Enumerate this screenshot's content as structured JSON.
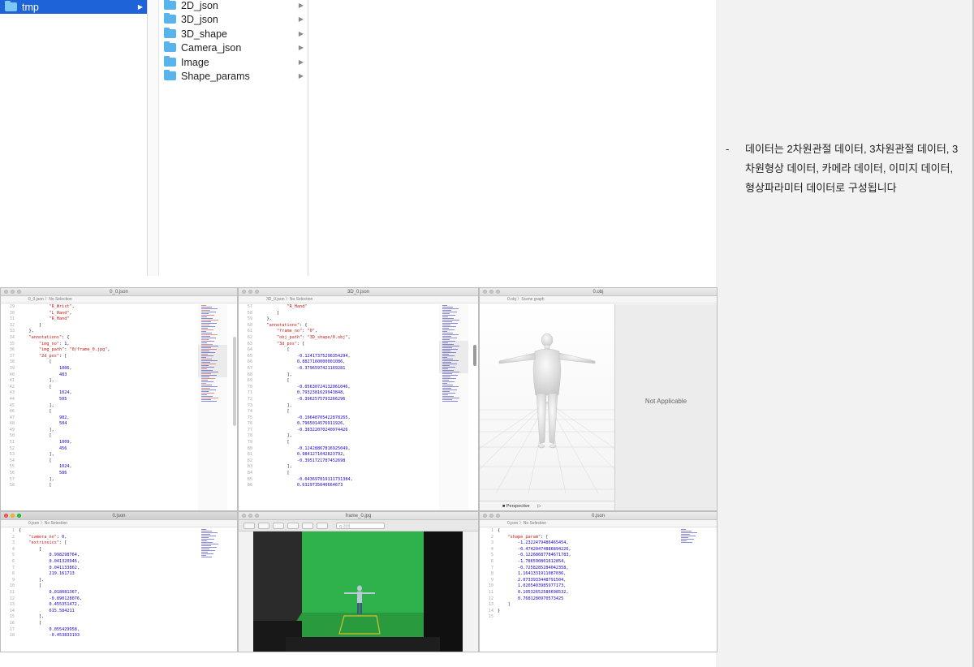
{
  "finder": {
    "column1": [
      {
        "label": "tmp",
        "selected": true
      }
    ],
    "column2": [
      {
        "label": "2D_json"
      },
      {
        "label": "3D_json"
      },
      {
        "label": "3D_shape"
      },
      {
        "label": "Camera_json"
      },
      {
        "label": "Image"
      },
      {
        "label": "Shape_params"
      }
    ]
  },
  "note": {
    "dash": "-",
    "text": "데이터는 2차원관절 데이터, 3차원관절 데이터, 3차원형상 데이터, 카메라 데이터, 이미지 데이터, 형상파라미터 데이터로 구성됩니다"
  },
  "windows": {
    "w1": {
      "title": "0_0.json",
      "jump": "0_0.json 〉No Selection",
      "line_numbers": [
        "29",
        "30",
        "31",
        "32",
        "33",
        "34",
        "35",
        "36",
        "37",
        "38",
        "39",
        "40",
        "41",
        "42",
        "43",
        "44",
        "45",
        "46",
        "47",
        "48",
        "49",
        "50",
        "51",
        "52",
        "53",
        "54",
        "55",
        "56",
        "57",
        "58"
      ],
      "lines": [
        "            \"R_Wrist\",",
        "            \"L_Hand\",",
        "            \"R_Hand\"",
        "        ]",
        "    },",
        "    \"annotations\": {",
        "        \"img_no\": 1,",
        "        \"img_path\": \"0/frame_0.jpg\",",
        "        \"2d_pos\": [",
        "            [",
        "                1006,",
        "                483",
        "            ],",
        "            [",
        "                1024,",
        "                505",
        "            ],",
        "            [",
        "                982,",
        "                504",
        "            ],",
        "            [",
        "                1009,",
        "                456",
        "            ],",
        "            [",
        "                1024,",
        "                586",
        "            ],",
        "            ["
      ]
    },
    "w2": {
      "title": "3D_0.json",
      "jump": "3D_0.json 〉No Selection",
      "line_numbers": [
        "57",
        "58",
        "59",
        "60",
        "61",
        "62",
        "63",
        "64",
        "65",
        "66",
        "67",
        "68",
        "69",
        "70",
        "71",
        "72",
        "73",
        "74",
        "75",
        "76",
        "77",
        "78",
        "79",
        "80",
        "81",
        "82",
        "83",
        "84",
        "85",
        "86"
      ],
      "lines": [
        "            \"R_Hand\"",
        "        ]",
        "    },",
        "    \"annotations\": {",
        "        \"frame_no\": \"0\",",
        "        \"obj_path\": \"3D_shape/0.obj\",",
        "        \"3d_pos\": [",
        "            [",
        "                -0.12417375296354294,",
        "                0.8827160000001086,",
        "                -0.3796597421169281",
        "            ],",
        "            [",
        "                -0.05630724132061046,",
        "                0.7932381629943848,",
        "                -0.3962575793266296",
        "            ],",
        "            [",
        "                -0.19648705422878265,",
        "                0.7965014576911926,",
        "                -0.38322070240974426",
        "            ],",
        "            [",
        "                -0.12428867816925049,",
        "                0.9841271042823792,",
        "                -0.3951721787452698",
        "            ],",
        "            [",
        "                -0.043697819111731384,",
        "                0.6329735040664673"
      ]
    },
    "w3": {
      "title": "0.obj",
      "jump": "0.obj 〉Scene graph",
      "not_applicable": "Not Applicable",
      "camera_mode": "Perspective"
    },
    "w4": {
      "title": "0.json",
      "jump": "0.json 〉No Selection",
      "line_numbers": [
        "1",
        "2",
        "3",
        "4",
        "5",
        "6",
        "7",
        "8",
        "9",
        "10",
        "11",
        "12",
        "13",
        "14",
        "15",
        "16",
        "17",
        "18"
      ],
      "lines": [
        "{",
        "    \"camera_no\": 0,",
        "    \"extrinsics\": [",
        "        [",
        "            0.998298764,",
        "            0.041320946,",
        "            0.041133862,",
        "            219.161713",
        "        ],",
        "        [",
        "            0.018081367,",
        "            -0.890128076,",
        "            0.455351472,",
        "            615.584211",
        "        ],",
        "        [",
        "            0.055429958,",
        "            -0.453833193"
      ]
    },
    "w5": {
      "title": "frame_0.jpg",
      "search_placeholder": "Q 검색"
    },
    "w6": {
      "title": "0.json",
      "jump": "0.json 〉No Selection",
      "line_numbers": [
        "1",
        "2",
        "3",
        "4",
        "5",
        "6",
        "7",
        "8",
        "9",
        "10",
        "11",
        "12",
        "13",
        "14",
        "15"
      ],
      "lines": [
        "{",
        "    \"shape_param\": [",
        "        -1.2322479486465454,",
        "        -0.47420474886894226,",
        "        -0.12268687784671783,",
        "        -1.786590801612854,",
        "        -0.7258285284042358,",
        "        1.1641331911087036,",
        "        2.0733933448791504,",
        "        1.0265403985977173,",
        "        0.10532652586698532,",
        "        0.7681280970573425",
        "    ]",
        "}",
        ""
      ]
    }
  }
}
